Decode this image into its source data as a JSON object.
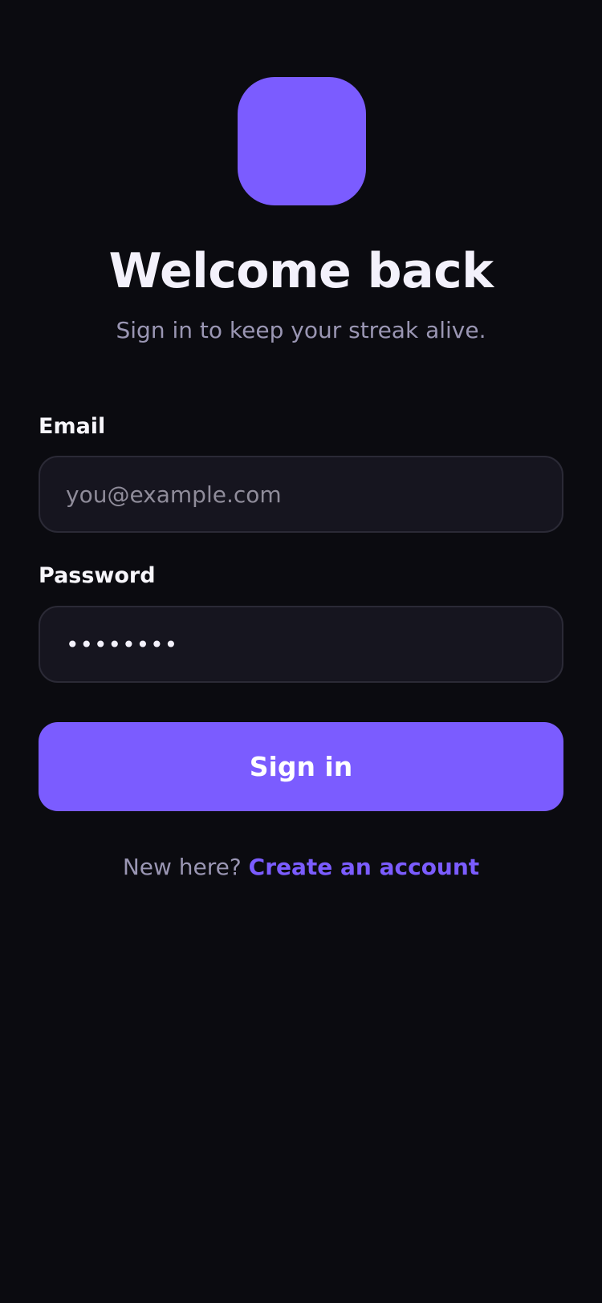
{
  "theme": {
    "background": "#0b0b10",
    "accent": "#7b5cff",
    "text_primary": "#f3f1fb",
    "text_secondary": "#9a96b3",
    "field_background": "#16151f",
    "field_border": "#2b2a36"
  },
  "logo": {
    "icon": "rounded-square-logo"
  },
  "header": {
    "title": "Welcome back",
    "subtitle": "Sign in to keep your streak alive."
  },
  "form": {
    "email": {
      "label": "Email",
      "value": "",
      "placeholder": "you@example.com"
    },
    "password": {
      "label": "Password",
      "value": "••••••••",
      "placeholder": ""
    },
    "submit_label": "Sign in"
  },
  "footer": {
    "prompt": "New here?",
    "link_label": "Create an account"
  }
}
